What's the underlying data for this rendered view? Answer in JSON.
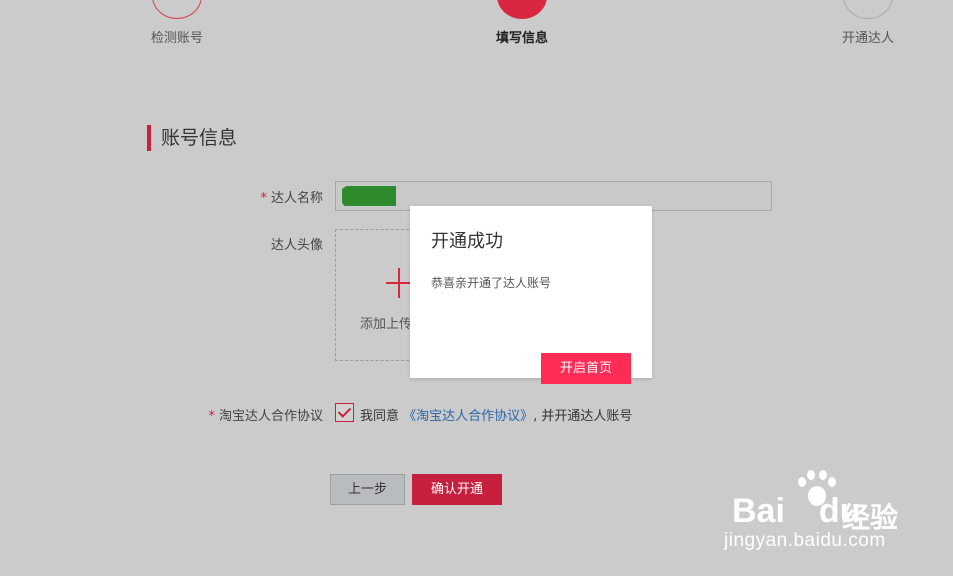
{
  "stepper": {
    "steps": [
      {
        "label": "检测账号"
      },
      {
        "label": "填写信息"
      },
      {
        "label": "开通达人"
      }
    ]
  },
  "section": {
    "title": "账号信息"
  },
  "form": {
    "required_mark": "*",
    "name_label": "达人名称",
    "avatar_label": "达人头像",
    "upload_text": "添加上传",
    "agreement_label": "淘宝达人合作协议",
    "agree_prefix": "我同意",
    "agree_link": "《淘宝达人合作协议》",
    "agree_suffix": ", 并开通达人账号",
    "agreement_checked": true
  },
  "buttons": {
    "prev": "上一步",
    "confirm": "确认开通"
  },
  "modal": {
    "title": "开通成功",
    "body": "恭喜亲开通了达人账号",
    "button": "开启首页"
  },
  "watermark": {
    "logo_text": "Bai",
    "logo_text2": "du",
    "logo_cn": "经验",
    "url": "jingyan.baidu.com"
  },
  "colors": {
    "accent": "#c6203e",
    "modal_button": "#ff2d55",
    "link": "#2866a8",
    "backdrop": "#cbcbcb"
  }
}
